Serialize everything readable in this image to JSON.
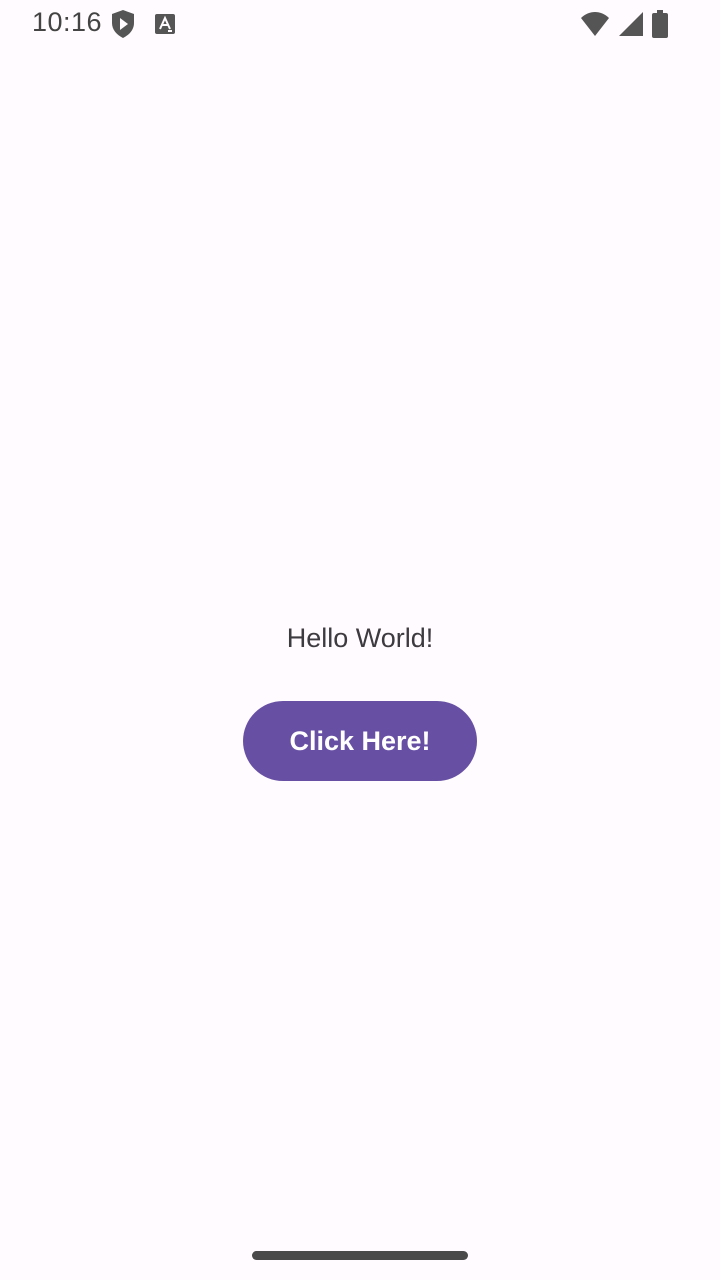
{
  "status_bar": {
    "time": "10:16",
    "left_icons": [
      "shield-play-icon",
      "keyboard-a-icon"
    ],
    "right_icons": [
      "wifi-icon",
      "cellular-signal-icon",
      "battery-icon"
    ]
  },
  "main": {
    "greeting": "Hello World!",
    "button_label": "Click Here!"
  },
  "colors": {
    "background": "#fffbfe",
    "button": "#6750a4",
    "button_text": "#ffffff",
    "text": "#3d3a40"
  },
  "navigation": {
    "gesture_handle": "gesture-bar"
  }
}
